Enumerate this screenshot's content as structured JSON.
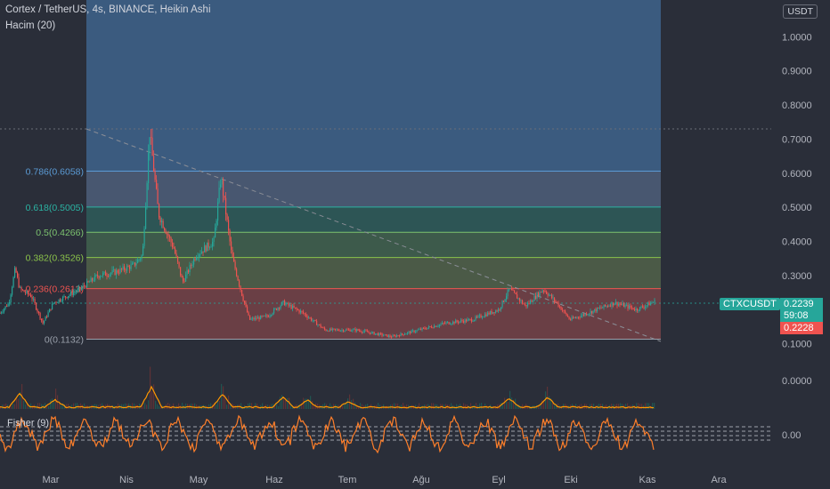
{
  "header": {
    "title": "Cortex / TetherUS, 4s, BINANCE, Heikin Ashi",
    "volume_label": "Hacim (20)",
    "currency": "USDT"
  },
  "price_axis": {
    "labels": [
      "1.0000",
      "0.9000",
      "0.8000",
      "0.7000",
      "0.6000",
      "0.5000",
      "0.4000",
      "0.3000",
      "0.1000",
      "0.0000",
      "0.00"
    ]
  },
  "time_axis": {
    "labels": [
      "Mar",
      "Nis",
      "May",
      "Haz",
      "Tem",
      "Ağu",
      "Eyl",
      "Eki",
      "Kas",
      "Ara"
    ]
  },
  "fib_levels": [
    {
      "label": "0.786(0.6058)",
      "ratio": 0.786,
      "price": 0.6058,
      "color": "#5b9bd5"
    },
    {
      "label": "0.618(0.5005)",
      "ratio": 0.618,
      "price": 0.5005,
      "color": "#2bb3a3"
    },
    {
      "label": "0.5(0.4266)",
      "ratio": 0.5,
      "price": 0.4266,
      "color": "#7cc36f"
    },
    {
      "label": "0.382(0.3526)",
      "ratio": 0.382,
      "price": 0.3526,
      "color": "#8bc34a"
    },
    {
      "label": "0.236(0.2613)",
      "ratio": 0.236,
      "price": 0.2613,
      "color": "#ef5350"
    },
    {
      "label": "0(0.1132)",
      "ratio": 0,
      "price": 0.1132,
      "color": "#9aa0ab"
    }
  ],
  "tags": {
    "symbol": "CTXCUSDT",
    "price": "0.2239",
    "countdown": "59:08",
    "prev_price": "0.2228"
  },
  "indicator": {
    "label": "Fisher (9)"
  },
  "colors": {
    "background": "#2a2e39",
    "up": "#26a69a",
    "down": "#ef5350",
    "volume_ma": "#ff9800",
    "fisher": "#ff7f2a"
  },
  "chart_data": {
    "type": "line",
    "title": "Cortex / TetherUS, 4s, BINANCE, Heikin Ashi",
    "x": [
      "Mar",
      "Nis",
      "May",
      "Haz",
      "Tem",
      "Ağu",
      "Eyl",
      "Eki",
      "Kas"
    ],
    "series": [
      {
        "name": "CTXCUSDT",
        "values": [
          0.21,
          0.29,
          0.38,
          0.2,
          0.14,
          0.17,
          0.23,
          0.21,
          0.2239
        ]
      }
    ],
    "ylim": [
      0.1,
      1.0
    ],
    "last_price": 0.2239
  }
}
